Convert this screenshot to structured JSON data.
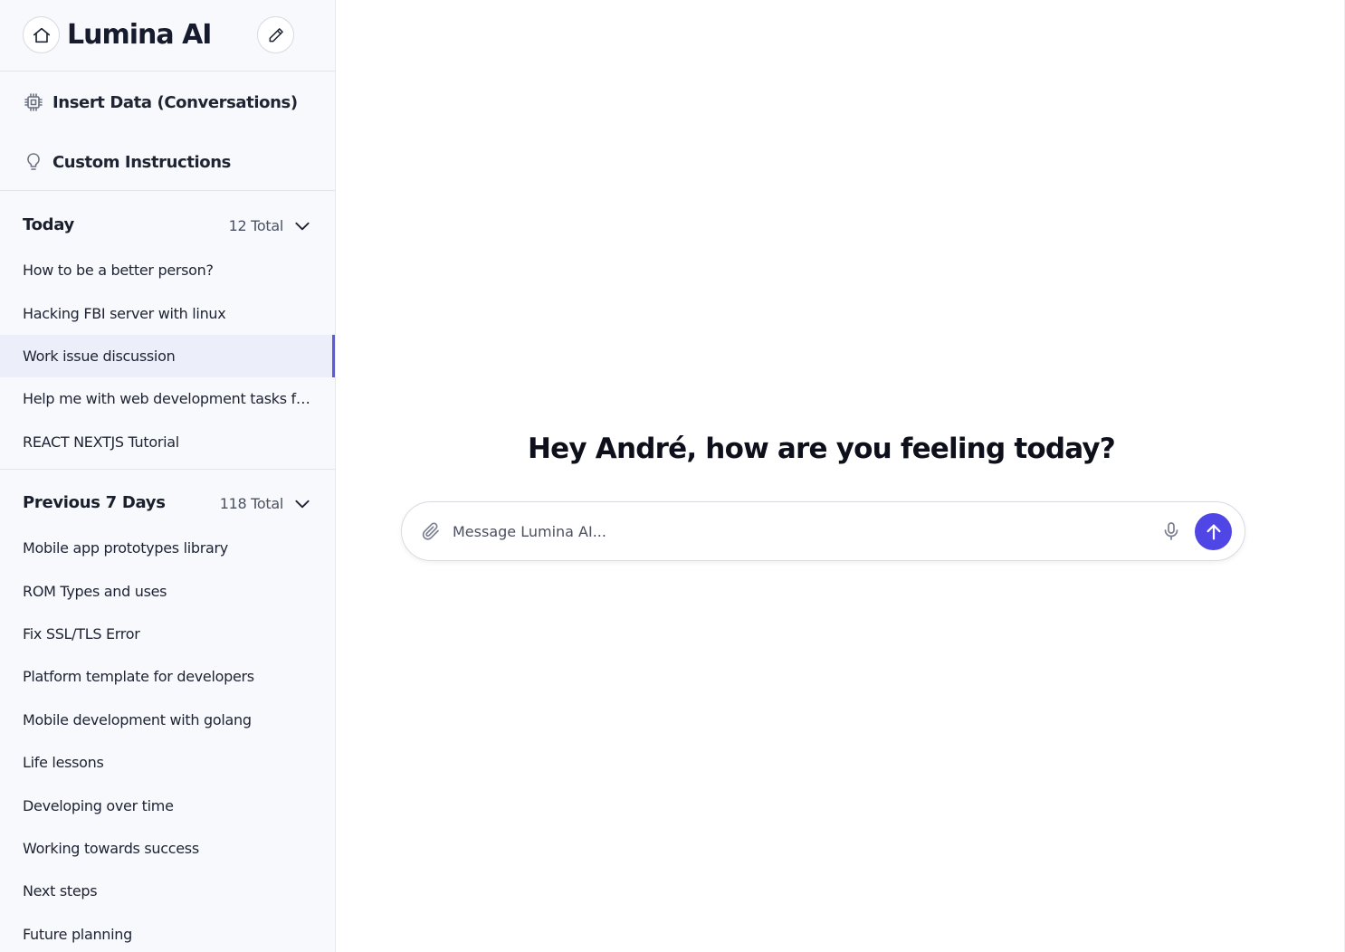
{
  "brand": {
    "title": "Lumina AI"
  },
  "tools": [
    {
      "label": "Insert Data (Conversations)",
      "icon": "cpu-chip-icon"
    },
    {
      "label": "Custom Instructions",
      "icon": "lightbulb-icon"
    }
  ],
  "sections": {
    "today": {
      "title": "Today",
      "count": "12 Total",
      "items": [
        "How to be a better person?",
        "Hacking FBI server with linux",
        "Work issue discussion",
        "Help me with web development tasks fr...",
        "REACT NEXTJS Tutorial"
      ],
      "active_index": 2
    },
    "previous": {
      "title": "Previous 7 Days",
      "count": "118 Total",
      "items": [
        "Mobile app prototypes library",
        "ROM Types and uses",
        "Fix SSL/TLS Error",
        "Platform template for developers",
        "Mobile development with golang",
        "Life lessons",
        "Developing over time",
        "Working towards success",
        "Next steps",
        "Future planning"
      ]
    }
  },
  "main": {
    "greeting": "Hey André, how are you feeling today?",
    "input_placeholder": "Message Lumina AI...",
    "input_value": ""
  },
  "colors": {
    "accent": "#4f46e5",
    "active_row_bg": "#eceff9",
    "sidebar_bg": "#f8f9fc"
  }
}
